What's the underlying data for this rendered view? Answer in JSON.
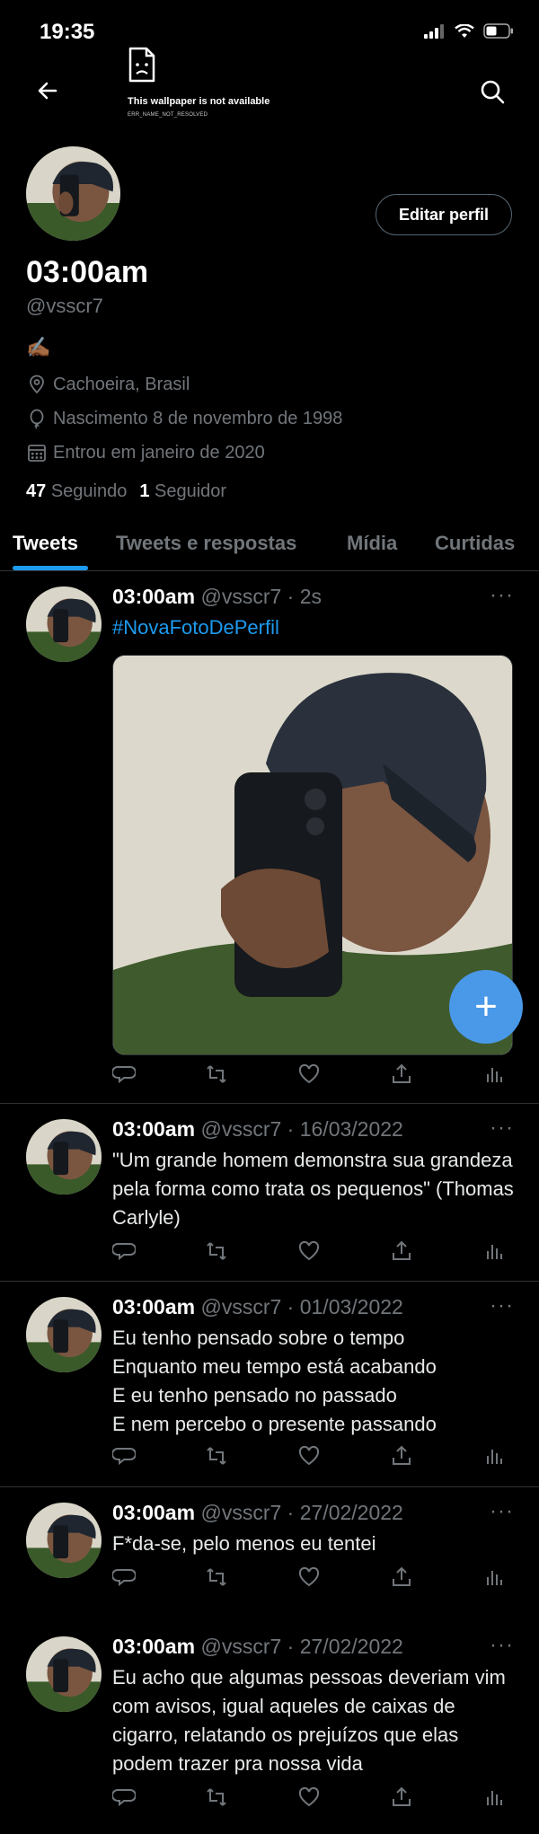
{
  "status": {
    "time": "19:35"
  },
  "wallpaper_error": {
    "message": "This wallpaper is not available",
    "code": "ERR_NAME_NOT_RESOLVED"
  },
  "header": {
    "back_icon": "arrow-left-icon",
    "search_icon": "search-icon"
  },
  "profile": {
    "edit_label": "Editar perfil",
    "name": "03:00am",
    "handle": "@vsscr7",
    "bio": "✍🏾",
    "location": "Cachoeira, Brasil",
    "birth": "Nascimento 8 de novembro de 1998",
    "joined": "Entrou em janeiro de 2020",
    "following_count": "47",
    "following_label": "Seguindo",
    "followers_count": "1",
    "followers_label": "Seguidor"
  },
  "tabs": [
    {
      "label": "Tweets",
      "active": true
    },
    {
      "label": "Tweets e respostas",
      "active": false
    },
    {
      "label": "Mídia",
      "active": false
    },
    {
      "label": "Curtidas",
      "active": false
    }
  ],
  "tweets": [
    {
      "name": "03:00am",
      "handle": "@vsscr7",
      "date": "· 2s",
      "text": "#NovaFotoDePerfil"
    },
    {
      "name": "03:00am",
      "handle": "@vsscr7",
      "date": "· 16/03/2022",
      "text": "\"Um grande homem demonstra sua grandeza pela forma como trata os pequenos\"  (Thomas Carlyle)"
    },
    {
      "name": "03:00am",
      "handle": "@vsscr7",
      "date": "· 01/03/2022",
      "lines": [
        "Eu tenho pensado sobre o tempo",
        "Enquanto meu tempo está acabando",
        "E eu tenho pensado no passado",
        "E nem percebo o presente passando"
      ]
    },
    {
      "name": "03:00am",
      "handle": "@vsscr7",
      "date": "· 27/02/2022",
      "text": "F*da-se, pelo menos eu tentei"
    },
    {
      "name": "03:00am",
      "handle": "@vsscr7",
      "date": "· 27/02/2022",
      "text": "Eu acho que algumas pessoas deveriam vim com avisos, igual aqueles de caixas de cigarro, relatando os prejuízos que elas podem trazer pra nossa vida"
    }
  ],
  "more_label": "···",
  "fab_label": "+",
  "colors": {
    "accent": "#1d9bf0",
    "fab": "#4a99e9",
    "muted": "#71767b",
    "background": "#000000"
  }
}
